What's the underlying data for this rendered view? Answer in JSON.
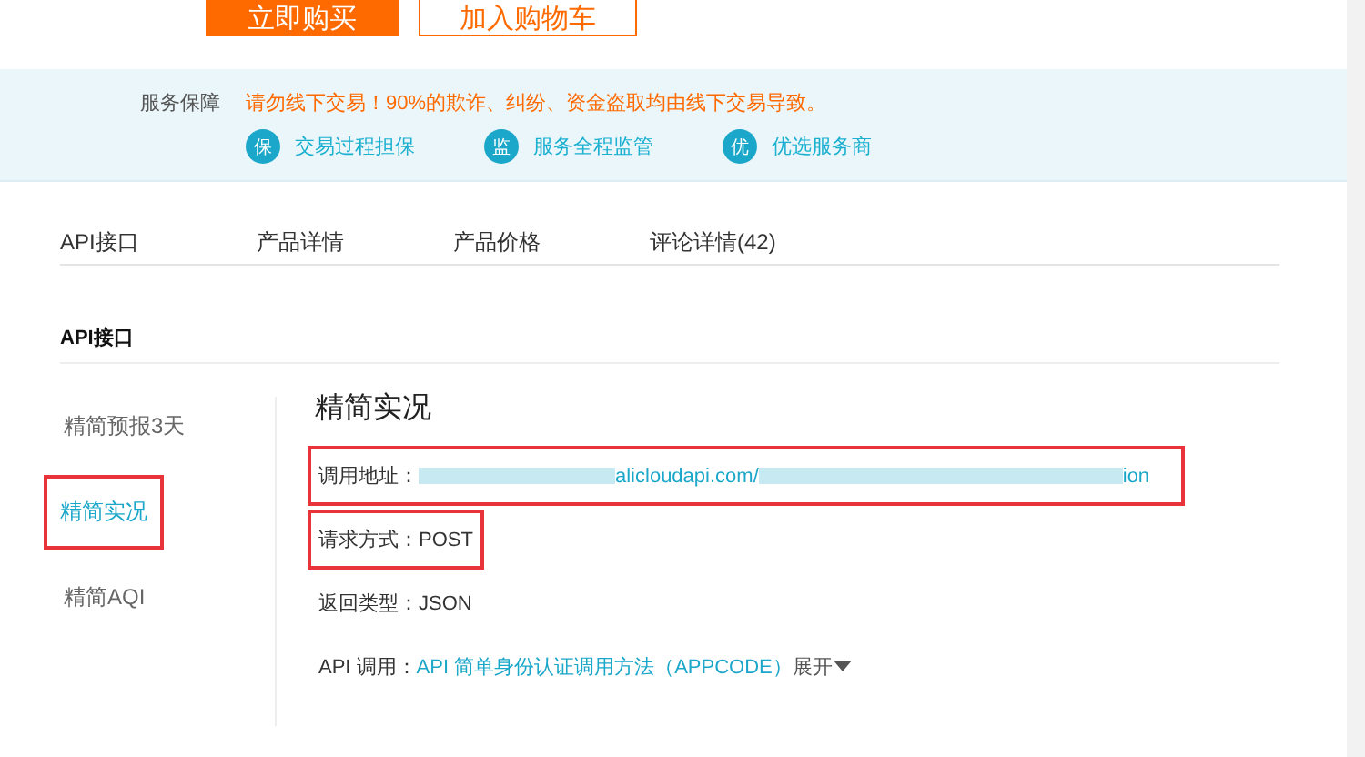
{
  "buy_buttons": [
    {
      "label": "立即购买",
      "kind": "primary"
    },
    {
      "label": "加入购物车",
      "kind": "secondary"
    }
  ],
  "service": {
    "label": "服务保障",
    "warning": "请勿线下交易！90%的欺诈、纠纷、资金盗取均由线下交易导致。",
    "badges": [
      {
        "icon_char": "保",
        "label": "交易过程担保"
      },
      {
        "icon_char": "监",
        "label": "服务全程监管"
      },
      {
        "icon_char": "优",
        "label": "优选服务商"
      }
    ]
  },
  "tabs": [
    {
      "label": "API接口"
    },
    {
      "label": "产品详情"
    },
    {
      "label": "产品价格"
    },
    {
      "label": "评论详情(42)"
    }
  ],
  "section_title": "API接口",
  "sidebar": {
    "items": [
      {
        "label": "精简预报3天",
        "selected": false,
        "highlighted": false
      },
      {
        "label": "精简实况",
        "selected": true,
        "highlighted": true
      },
      {
        "label": "精简AQI",
        "selected": false,
        "highlighted": false
      }
    ]
  },
  "detail": {
    "title": "精简实况",
    "fields": [
      {
        "kind": "url",
        "label": "调用地址：",
        "fragments": [
          "alicloudapi.com/",
          "ion"
        ],
        "highlighted": true
      },
      {
        "kind": "text",
        "label": "请求方式：",
        "value": "POST",
        "highlighted": true
      },
      {
        "kind": "text",
        "label": "返回类型：",
        "value": "JSON",
        "highlighted": false
      },
      {
        "kind": "link",
        "label": "API 调用：",
        "value": "API 简单身份认证调用方法（APPCODE）",
        "toggle": "展开",
        "highlighted": false
      }
    ]
  }
}
